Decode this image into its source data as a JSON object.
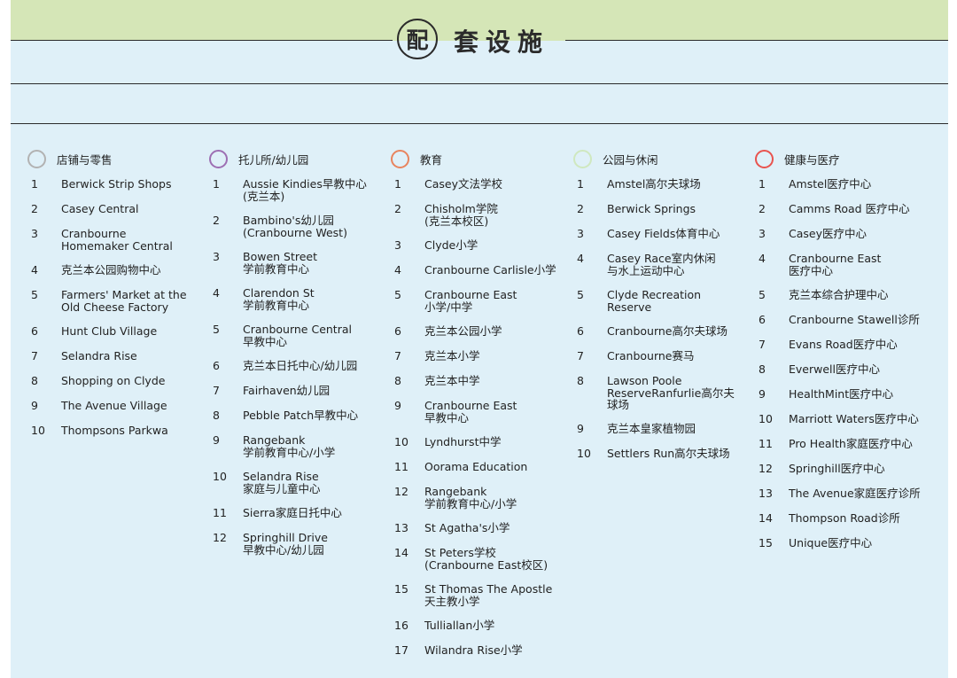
{
  "title": {
    "circle_char": "配",
    "rest": "套设施"
  },
  "columns": [
    {
      "heading": "店铺与零售",
      "ring_color": "#b2b2b2",
      "items": [
        {
          "num": "1",
          "text": "Berwick Strip Shops"
        },
        {
          "num": "2",
          "text": "Casey Central"
        },
        {
          "num": "3",
          "text": "Cranbourne\nHomemaker Central"
        },
        {
          "num": "4",
          "text": "克兰本公园购物中心"
        },
        {
          "num": "5",
          "text": "Farmers' Market at the\nOld Cheese Factory"
        },
        {
          "num": "6",
          "text": "Hunt Club Village"
        },
        {
          "num": "7",
          "text": "Selandra Rise"
        },
        {
          "num": "8",
          "text": "Shopping on Clyde"
        },
        {
          "num": "9",
          "text": "The Avenue Village"
        },
        {
          "num": "10",
          "text": "Thompsons Parkwa"
        }
      ]
    },
    {
      "heading": "托儿所/幼儿园",
      "ring_color": "#9d6fb3",
      "items": [
        {
          "num": "1",
          "text": "Aussie Kindies早教中心\n(克兰本)"
        },
        {
          "num": "2",
          "text": "Bambino's幼儿园\n(Cranbourne West)"
        },
        {
          "num": "3",
          "text": "Bowen Street\n学前教育中心"
        },
        {
          "num": "4",
          "text": "Clarendon St\n学前教育中心"
        },
        {
          "num": "5",
          "text": "Cranbourne Central\n早教中心"
        },
        {
          "num": "6",
          "text": "克兰本日托中心/幼儿园"
        },
        {
          "num": "7",
          "text": "Fairhaven幼儿园"
        },
        {
          "num": "8",
          "text": "Pebble Patch早教中心"
        },
        {
          "num": "9",
          "text": "Rangebank\n学前教育中心/小学"
        },
        {
          "num": "10",
          "text": "Selandra Rise\n家庭与儿童中心"
        },
        {
          "num": "11",
          "text": "Sierra家庭日托中心"
        },
        {
          "num": "12",
          "text": "Springhill Drive\n早教中心/幼儿园"
        }
      ]
    },
    {
      "heading": "教育",
      "ring_color": "#e8845e",
      "items": [
        {
          "num": "1",
          "text": "Casey文法学校"
        },
        {
          "num": "2",
          "text": "Chisholm学院\n(克兰本校区)"
        },
        {
          "num": "3",
          "text": "Clyde小学"
        },
        {
          "num": "4",
          "text": "Cranbourne Carlisle小学"
        },
        {
          "num": "5",
          "text": "Cranbourne East\n小学/中学"
        },
        {
          "num": "6",
          "text": "克兰本公园小学"
        },
        {
          "num": "7",
          "text": "克兰本小学"
        },
        {
          "num": "8",
          "text": "克兰本中学"
        },
        {
          "num": "9",
          "text": "Cranbourne East\n早教中心"
        },
        {
          "num": "10",
          "text": "Lyndhurst中学"
        },
        {
          "num": "11",
          "text": "Oorama Education"
        },
        {
          "num": "12",
          "text": "Rangebank\n学前教育中心/小学"
        },
        {
          "num": "13",
          "text": "St Agatha's小学"
        },
        {
          "num": "14",
          "text": "St Peters学校\n(Cranbourne East校区)"
        },
        {
          "num": "15",
          "text": "St Thomas The Apostle\n天主教小学"
        },
        {
          "num": "16",
          "text": "Tulliallan小学"
        },
        {
          "num": "17",
          "text": "Wilandra Rise小学"
        }
      ]
    },
    {
      "heading": "公园与休闲",
      "ring_color": "#cfe8bf",
      "items": [
        {
          "num": "1",
          "text": "Amstel高尔夫球场"
        },
        {
          "num": "2",
          "text": "Berwick Springs"
        },
        {
          "num": "3",
          "text": "Casey Fields体育中心"
        },
        {
          "num": "4",
          "text": "Casey Race室内休闲\n与水上运动中心"
        },
        {
          "num": "5",
          "text": "Clyde Recreation\nReserve"
        },
        {
          "num": "6",
          "text": "Cranbourne高尔夫球场"
        },
        {
          "num": "7",
          "text": "Cranbourne赛马"
        },
        {
          "num": "8",
          "text": "Lawson Poole\nReserveRanfurlie高尔夫\n球场"
        },
        {
          "num": "9",
          "text": "克兰本皇家植物园"
        },
        {
          "num": "10",
          "text": "Settlers Run高尔夫球场"
        }
      ]
    },
    {
      "heading": "健康与医疗",
      "ring_color": "#e8534e",
      "items": [
        {
          "num": "1",
          "text": "Amstel医疗中心"
        },
        {
          "num": "2",
          "text": "Camms Road 医疗中心"
        },
        {
          "num": "3",
          "text": "Casey医疗中心"
        },
        {
          "num": "4",
          "text": "Cranbourne East\n医疗中心"
        },
        {
          "num": "5",
          "text": "克兰本综合护理中心"
        },
        {
          "num": "6",
          "text": "Cranbourne Stawell诊所"
        },
        {
          "num": "7",
          "text": "Evans Road医疗中心"
        },
        {
          "num": "8",
          "text": "Everwell医疗中心"
        },
        {
          "num": "9",
          "text": "HealthMint医疗中心"
        },
        {
          "num": "10",
          "text": "Marriott Waters医疗中心"
        },
        {
          "num": "11",
          "text": "Pro Health家庭医疗中心"
        },
        {
          "num": "12",
          "text": "Springhill医疗中心"
        },
        {
          "num": "13",
          "text": "The Avenue家庭医疗诊所"
        },
        {
          "num": "14",
          "text": "Thompson Road诊所"
        },
        {
          "num": "15",
          "text": "Unique医疗中心"
        }
      ]
    }
  ]
}
